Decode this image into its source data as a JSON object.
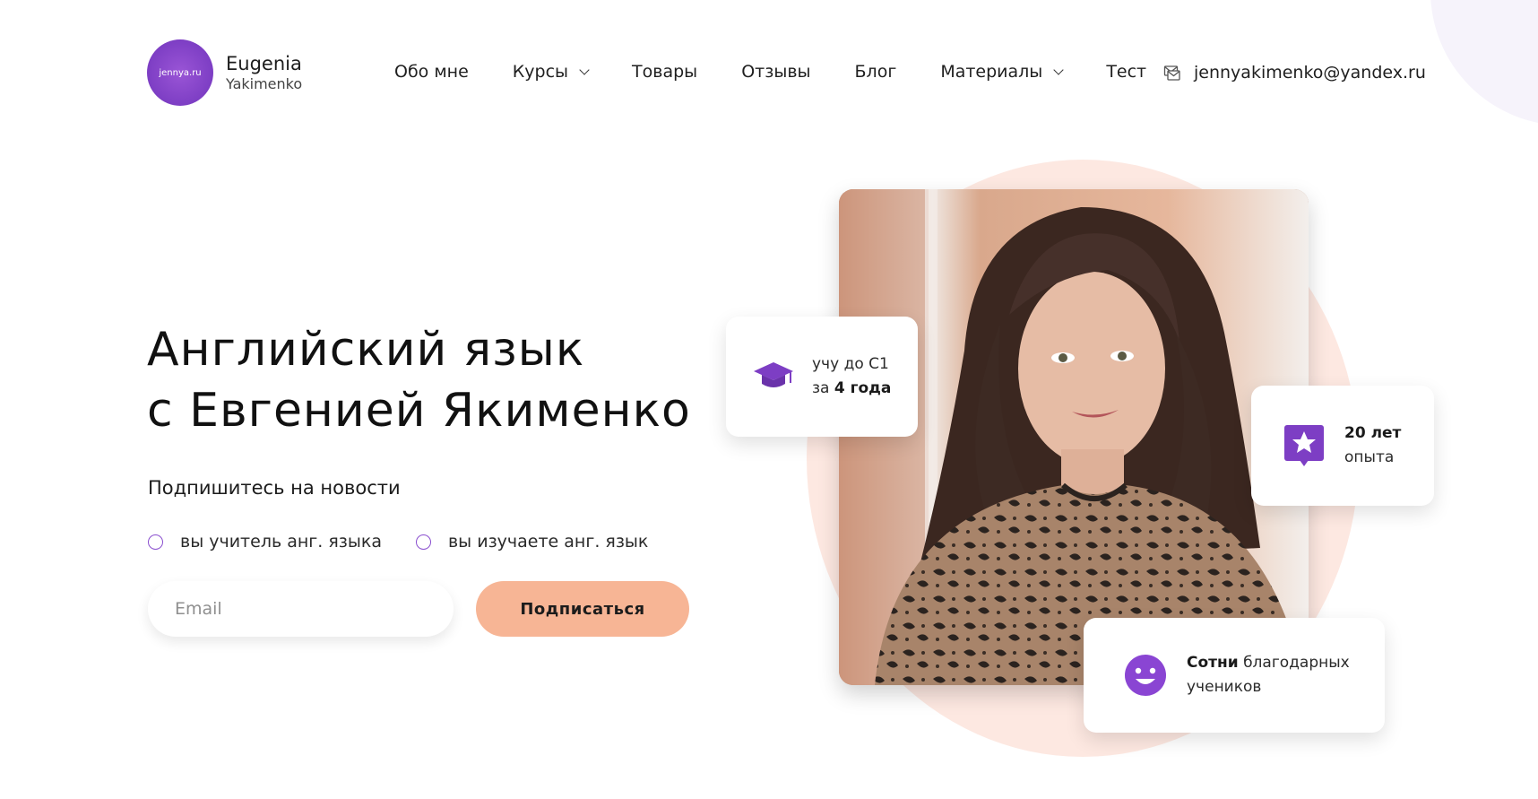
{
  "brand": {
    "logo_text": "jennya.ru",
    "first_name": "Eugenia",
    "last_name": "Yakimenko",
    "accent_color": "#7d3ec4"
  },
  "nav": {
    "items": [
      {
        "label": "Обо мне",
        "has_dropdown": false
      },
      {
        "label": "Курсы",
        "has_dropdown": true
      },
      {
        "label": "Товары",
        "has_dropdown": false
      },
      {
        "label": "Отзывы",
        "has_dropdown": false
      },
      {
        "label": "Блог",
        "has_dropdown": false
      },
      {
        "label": "Материалы",
        "has_dropdown": true
      },
      {
        "label": "Тест",
        "has_dropdown": false
      }
    ],
    "email": "jennyakimenko@yandex.ru",
    "email_icon": "mail-icon"
  },
  "hero": {
    "title_line1": "Английский язык",
    "title_line2": "с Евгенией Якименко",
    "subscribe_label": "Подпишитесь на новости",
    "radio_options": [
      "вы учитель анг. языка",
      "вы изучаете анг. язык"
    ],
    "email_placeholder": "Email",
    "email_value": "",
    "subscribe_button": "Подписаться",
    "button_color": "#f7b595"
  },
  "cards": [
    {
      "icon": "graduation-cap-icon",
      "line1": "учу до С1",
      "line2_prefix": "за ",
      "line2_bold": "4 года"
    },
    {
      "icon": "star-badge-icon",
      "line1_bold": "20 лет",
      "line2": "опыта"
    },
    {
      "icon": "smiley-icon",
      "line1_bold": "Сотни",
      "line1_rest": " благодарных",
      "line2": "учеников"
    }
  ]
}
